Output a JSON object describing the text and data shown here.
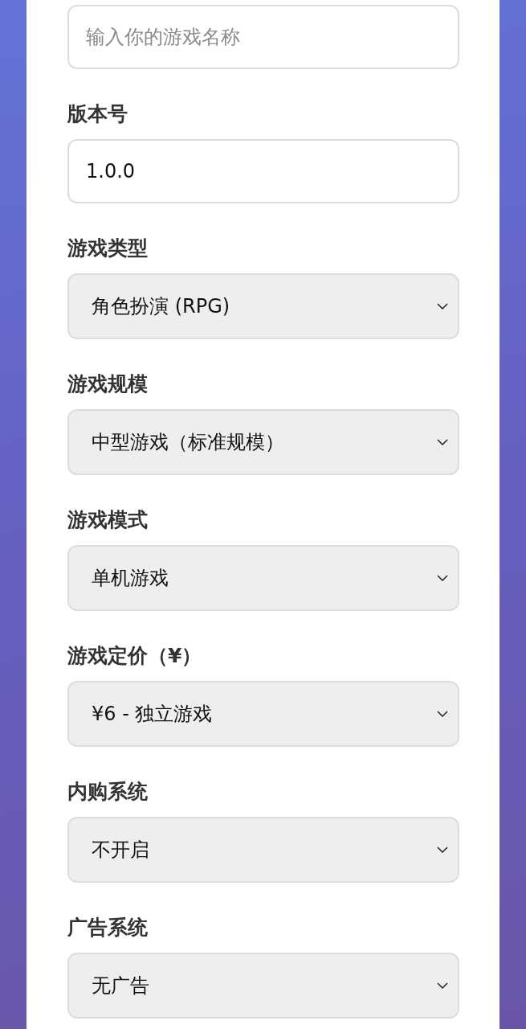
{
  "form": {
    "fields": [
      {
        "kind": "text",
        "placeholder": "输入你的游戏名称"
      },
      {
        "kind": "text",
        "label": "版本号",
        "value": "1.0.0"
      },
      {
        "kind": "select",
        "label": "游戏类型",
        "value": "角色扮演 (RPG)"
      },
      {
        "kind": "select",
        "label": "游戏规模",
        "value": "中型游戏（标准规模）"
      },
      {
        "kind": "select",
        "label": "游戏模式",
        "value": "单机游戏"
      },
      {
        "kind": "select",
        "label": "游戏定价（¥）",
        "value": "¥6 - 独立游戏"
      },
      {
        "kind": "select",
        "label": "内购系统",
        "value": "不开启"
      },
      {
        "kind": "select",
        "label": "广告系统",
        "value": "无广告"
      }
    ]
  }
}
